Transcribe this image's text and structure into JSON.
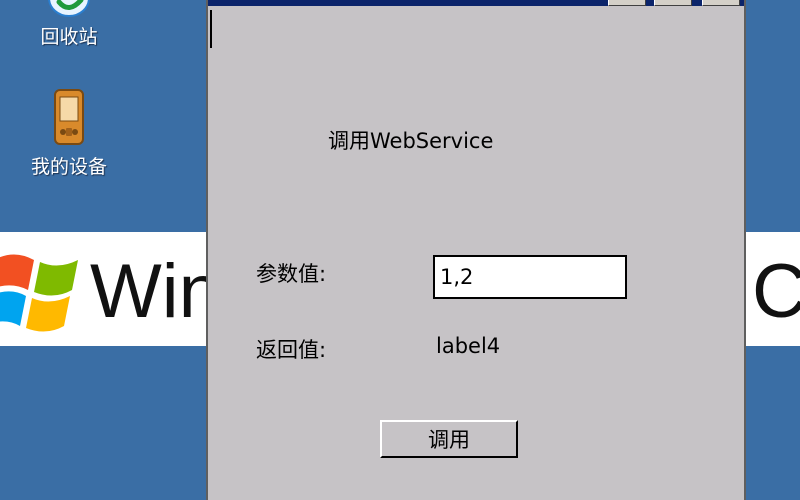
{
  "desktop": {
    "icons": [
      {
        "label": "回收站",
        "icon": "recycle-bin-icon"
      },
      {
        "label": "我的设备",
        "icon": "pda-device-icon"
      }
    ],
    "banner": {
      "text_left": "Win",
      "text_right": "C"
    }
  },
  "app": {
    "title": "调用WebService",
    "param_label": "参数值:",
    "param_value": "1,2",
    "return_label": "返回值:",
    "return_value": "label4",
    "invoke_button": "调用"
  },
  "colors": {
    "desktop": "#3a6ea5",
    "window_body": "#c6c3c6",
    "titlebar": "#0b246a"
  }
}
